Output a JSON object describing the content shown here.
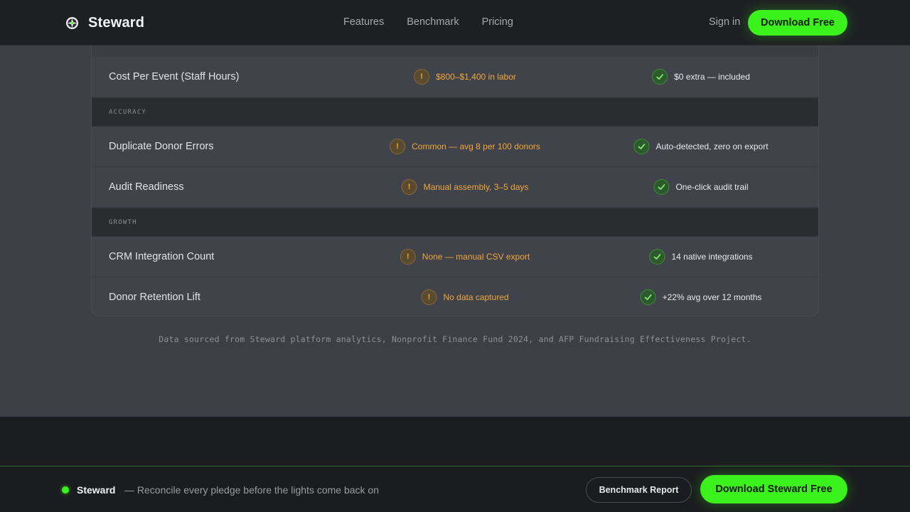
{
  "nav": {
    "brand": "Steward",
    "links": [
      "Features",
      "Benchmark",
      "Pricing"
    ],
    "signin": "Sign in",
    "cta": "Download Free"
  },
  "table": {
    "rows": [
      {
        "type": "data",
        "metric": "Cost Per Event (Staff Hours)",
        "old": "$800–$1,400 in labor",
        "new": "$0 extra — included"
      },
      {
        "type": "section",
        "label": "ACCURACY"
      },
      {
        "type": "data",
        "metric": "Duplicate Donor Errors",
        "old": "Common — avg 8 per 100 donors",
        "new": "Auto-detected, zero on export"
      },
      {
        "type": "data",
        "metric": "Audit Readiness",
        "old": "Manual assembly, 3–5 days",
        "new": "One-click audit trail"
      },
      {
        "type": "section",
        "label": "GROWTH"
      },
      {
        "type": "data",
        "metric": "CRM Integration Count",
        "old": "None — manual CSV export",
        "new": "14 native integrations"
      },
      {
        "type": "data",
        "metric": "Donor Retention Lift",
        "old": "No data captured",
        "new": "+22% avg over 12 months"
      }
    ],
    "footnote": "Data sourced from Steward platform analytics, Nonprofit Finance Fund 2024, and AFP Fundraising Effectiveness Project."
  },
  "sticky_bar": {
    "brand": "Steward",
    "tagline": "— Reconcile every pledge before the lights come back on",
    "secondary_cta": "Benchmark Report",
    "primary_cta": "Download Steward Free"
  },
  "icons": {
    "warning": "exclamation-circle-icon",
    "check": "check-circle-icon",
    "logo": "compass-logo-icon"
  },
  "colors": {
    "accent": "#3cf21d",
    "warning": "#f0a63a",
    "success": "#3f8d3a",
    "background": "#3d3f47",
    "nav": "#1e1f23"
  }
}
